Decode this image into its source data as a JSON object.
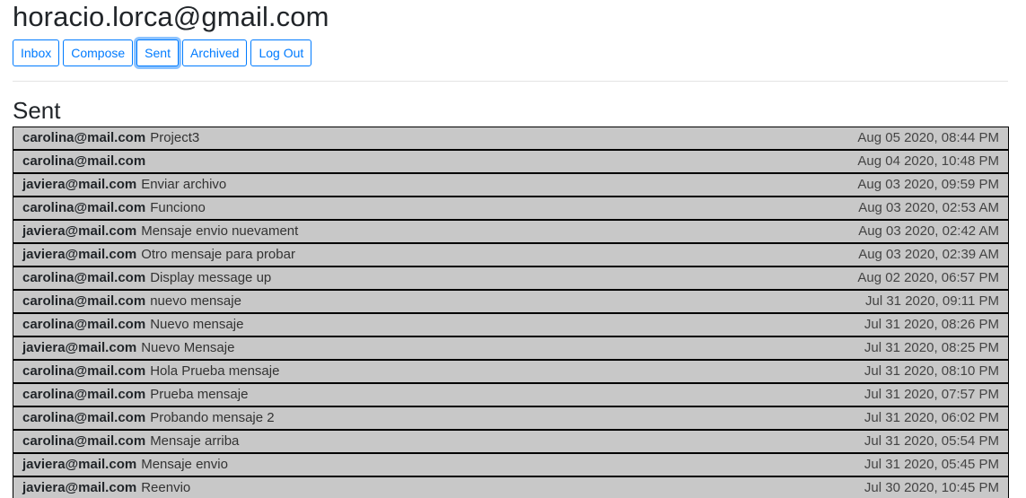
{
  "user_email": "horacio.lorca@gmail.com",
  "nav": {
    "inbox": "Inbox",
    "compose": "Compose",
    "sent": "Sent",
    "archived": "Archived",
    "logout": "Log Out"
  },
  "section_title": "Sent",
  "colors": {
    "accent": "#007bff",
    "row_background": "#c8c8c8",
    "row_border": "#000000"
  },
  "emails": [
    {
      "sender": "carolina@mail.com",
      "subject": "Project3",
      "timestamp": "Aug 05 2020, 08:44 PM"
    },
    {
      "sender": "carolina@mail.com",
      "subject": "",
      "timestamp": "Aug 04 2020, 10:48 PM"
    },
    {
      "sender": "javiera@mail.com",
      "subject": "Enviar archivo",
      "timestamp": "Aug 03 2020, 09:59 PM"
    },
    {
      "sender": "carolina@mail.com",
      "subject": "Funciono",
      "timestamp": "Aug 03 2020, 02:53 AM"
    },
    {
      "sender": "javiera@mail.com",
      "subject": "Mensaje envio nuevament",
      "timestamp": "Aug 03 2020, 02:42 AM"
    },
    {
      "sender": "javiera@mail.com",
      "subject": "Otro mensaje para probar",
      "timestamp": "Aug 03 2020, 02:39 AM"
    },
    {
      "sender": "carolina@mail.com",
      "subject": "Display message up",
      "timestamp": "Aug 02 2020, 06:57 PM"
    },
    {
      "sender": "carolina@mail.com",
      "subject": "nuevo mensaje",
      "timestamp": "Jul 31 2020, 09:11 PM"
    },
    {
      "sender": "carolina@mail.com",
      "subject": "Nuevo mensaje",
      "timestamp": "Jul 31 2020, 08:26 PM"
    },
    {
      "sender": "javiera@mail.com",
      "subject": "Nuevo Mensaje",
      "timestamp": "Jul 31 2020, 08:25 PM"
    },
    {
      "sender": "carolina@mail.com",
      "subject": "Hola Prueba mensaje",
      "timestamp": "Jul 31 2020, 08:10 PM"
    },
    {
      "sender": "carolina@mail.com",
      "subject": "Prueba mensaje",
      "timestamp": "Jul 31 2020, 07:57 PM"
    },
    {
      "sender": "carolina@mail.com",
      "subject": "Probando mensaje 2",
      "timestamp": "Jul 31 2020, 06:02 PM"
    },
    {
      "sender": "carolina@mail.com",
      "subject": "Mensaje arriba",
      "timestamp": "Jul 31 2020, 05:54 PM"
    },
    {
      "sender": "javiera@mail.com",
      "subject": "Mensaje envio",
      "timestamp": "Jul 31 2020, 05:45 PM"
    },
    {
      "sender": "javiera@mail.com",
      "subject": "Reenvio",
      "timestamp": "Jul 30 2020, 10:45 PM"
    }
  ]
}
